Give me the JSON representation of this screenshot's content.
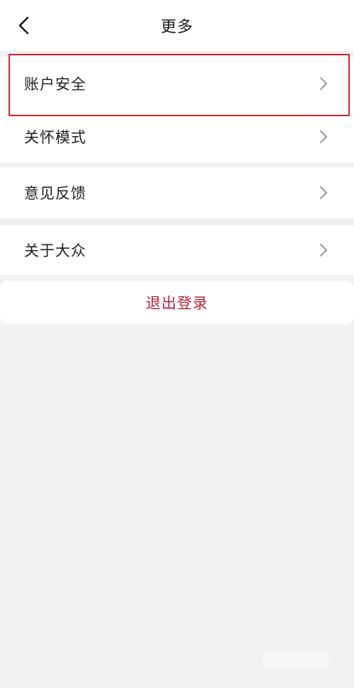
{
  "header": {
    "title": "更多",
    "back_icon": "chevron-left-icon"
  },
  "groups": [
    {
      "items": [
        {
          "label": "账户安全",
          "icon": "chevron-right-icon"
        },
        {
          "label": "关怀模式",
          "icon": "chevron-right-icon"
        }
      ]
    },
    {
      "items": [
        {
          "label": "意见反馈",
          "icon": "chevron-right-icon"
        }
      ]
    },
    {
      "items": [
        {
          "label": "关于大众",
          "icon": "chevron-right-icon"
        }
      ]
    }
  ],
  "logout": {
    "label": "退出登录"
  },
  "colors": {
    "background": "#f1f2f4",
    "card": "#ffffff",
    "logout_text": "#b8243c",
    "highlight_border": "#d8232a",
    "chevron": "#9a9a9a"
  }
}
